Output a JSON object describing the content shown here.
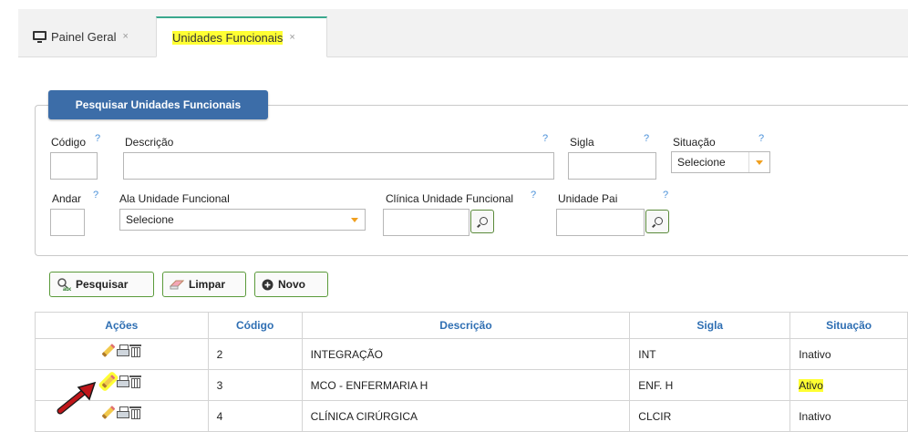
{
  "tabs": [
    {
      "label": "Painel Geral",
      "icon": "monitor-icon",
      "close": "×"
    },
    {
      "label": "Unidades Funcionais",
      "close": "×",
      "active": true,
      "highlight": "#ffff33"
    }
  ],
  "search_panel": {
    "title": "Pesquisar Unidades Funcionais",
    "help": "?",
    "fields": {
      "codigo": {
        "label": "Código",
        "value": ""
      },
      "descricao": {
        "label": "Descrição",
        "value": ""
      },
      "sigla": {
        "label": "Sigla",
        "value": ""
      },
      "situacao": {
        "label": "Situação",
        "selected": "Selecione"
      },
      "andar": {
        "label": "Andar",
        "value": ""
      },
      "ala": {
        "label": "Ala Unidade Funcional",
        "selected": "Selecione"
      },
      "clinica": {
        "label": "Clínica Unidade Funcional",
        "value": ""
      },
      "unidade_pai": {
        "label": "Unidade Pai",
        "value": ""
      }
    }
  },
  "buttons": {
    "pesquisar": "Pesquisar",
    "limpar": "Limpar",
    "novo": "Novo"
  },
  "table": {
    "columns": [
      "Ações",
      "Código",
      "Descrição",
      "Sigla",
      "Situação"
    ],
    "rows": [
      {
        "codigo": "2",
        "descricao": "INTEGRAÇÃO",
        "sigla": "INT",
        "situacao": "Inativo"
      },
      {
        "codigo": "3",
        "descricao": "MCO - ENFERMARIA H",
        "sigla": "ENF. H",
        "situacao": "Ativo",
        "highlight": true
      },
      {
        "codigo": "4",
        "descricao": "CLÍNICA CIRÚRGICA",
        "sigla": "CLCIR",
        "situacao": "Inativo"
      }
    ]
  },
  "colors": {
    "accent": "#3c6da8",
    "header_text": "#2f6fb3",
    "highlight": "#ffff33",
    "arrow": "#c0161a"
  }
}
